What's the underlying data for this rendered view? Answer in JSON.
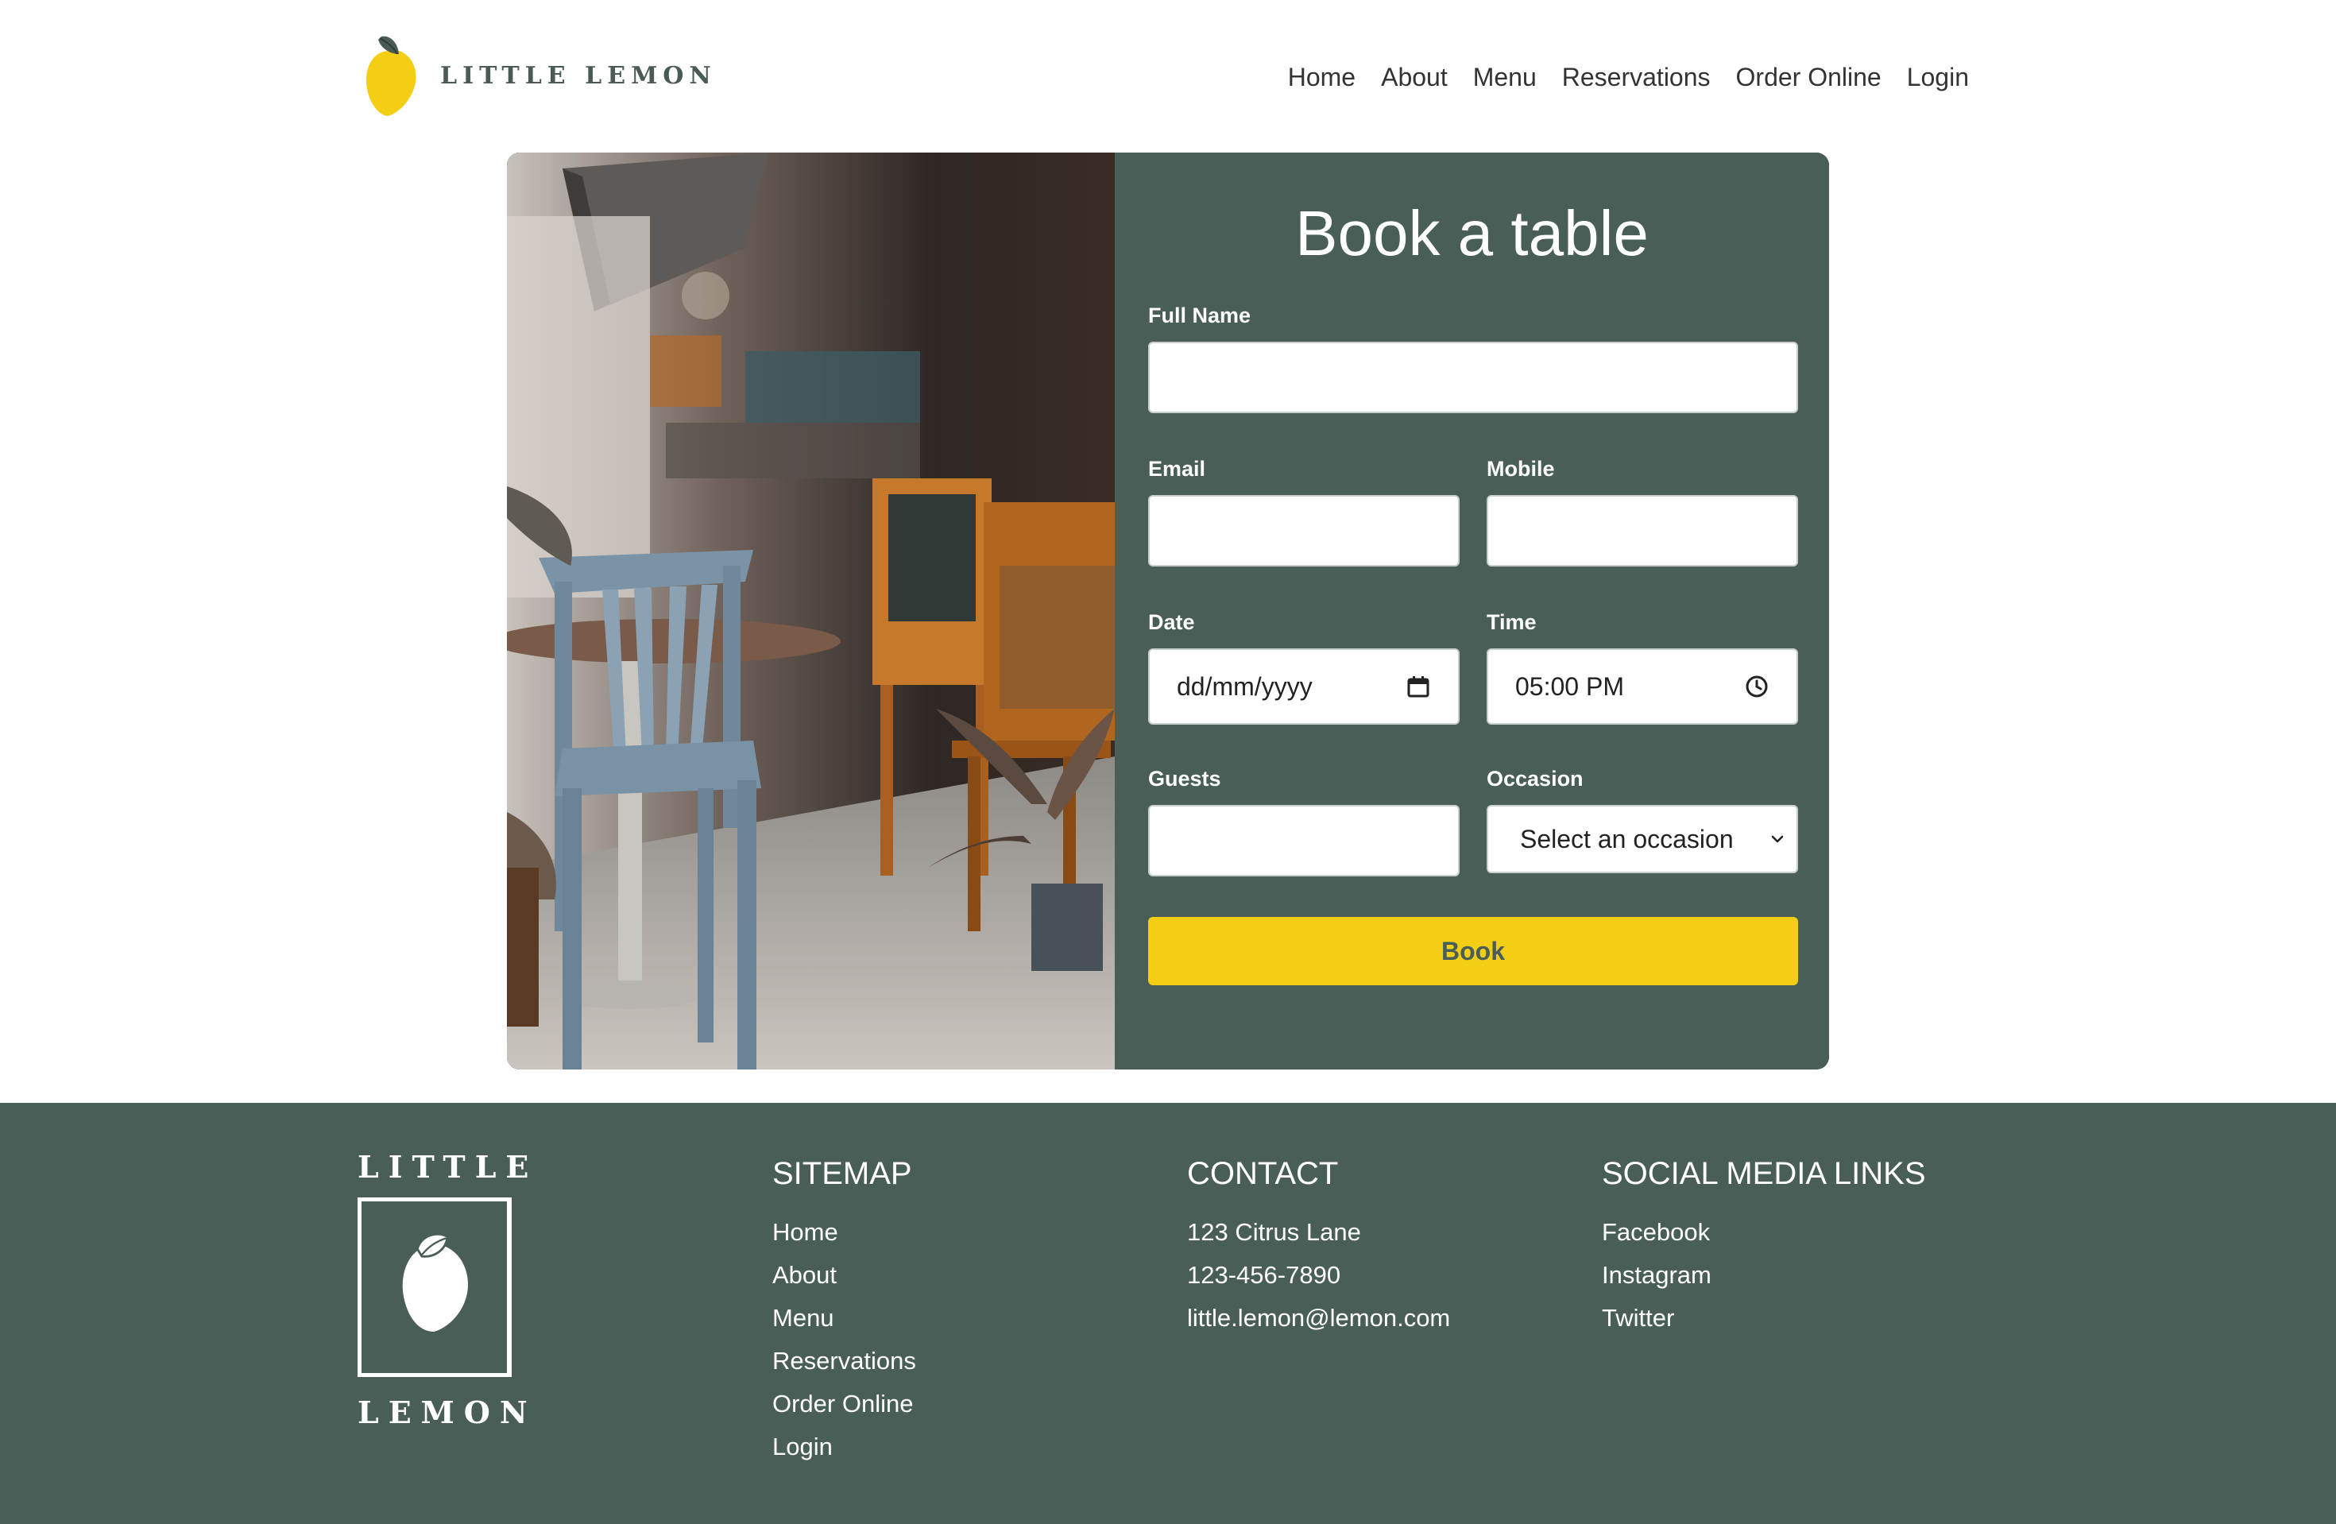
{
  "brand": {
    "logo_text": "LITTLE LEMON",
    "logo_icon": "lemon-icon",
    "primary_color": "#495e57",
    "accent_color": "#f4ce14"
  },
  "nav": {
    "items": [
      "Home",
      "About",
      "Menu",
      "Reservations",
      "Order Online",
      "Login"
    ]
  },
  "booking": {
    "title": "Book a table",
    "full_name": {
      "label": "Full Name",
      "value": ""
    },
    "email": {
      "label": "Email",
      "value": ""
    },
    "mobile": {
      "label": "Mobile",
      "value": ""
    },
    "date": {
      "label": "Date",
      "value": "dd/mm/yyyy",
      "icon": "calendar-icon"
    },
    "time": {
      "label": "Time",
      "value": "05:00 PM",
      "icon": "clock-icon"
    },
    "guests": {
      "label": "Guests",
      "value": ""
    },
    "occasion": {
      "label": "Occasion",
      "value": "Select an occasion",
      "icon": "chevron-down-icon"
    },
    "submit_label": "Book"
  },
  "footer": {
    "logo_top": "LITTLE",
    "logo_bottom": "LEMON",
    "sitemap": {
      "title": "SITEMAP",
      "links": [
        "Home",
        "About",
        "Menu",
        "Reservations",
        "Order Online",
        "Login"
      ]
    },
    "contact": {
      "title": "CONTACT",
      "lines": [
        "123 Citrus Lane",
        "123-456-7890",
        "little.lemon@lemon.com"
      ]
    },
    "social": {
      "title": "SOCIAL MEDIA LINKS",
      "links": [
        "Facebook",
        "Instagram",
        "Twitter"
      ]
    }
  }
}
